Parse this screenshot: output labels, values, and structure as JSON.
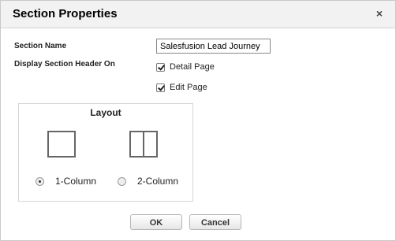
{
  "dialog": {
    "title": "Section Properties",
    "close_glyph": "×"
  },
  "form": {
    "section_name_label": "Section Name",
    "section_name_value": "Salesfusion Lead Journey",
    "display_header_label": "Display Section Header On",
    "options": [
      {
        "label": "Detail Page",
        "checked": true
      },
      {
        "label": "Edit Page",
        "checked": true
      }
    ]
  },
  "layout": {
    "title": "Layout",
    "choices": [
      {
        "label": "1-Column",
        "icon": "one-column-icon",
        "selected": true
      },
      {
        "label": "2-Column",
        "icon": "two-column-icon",
        "selected": false
      }
    ]
  },
  "buttons": {
    "ok": "OK",
    "cancel": "Cancel"
  }
}
